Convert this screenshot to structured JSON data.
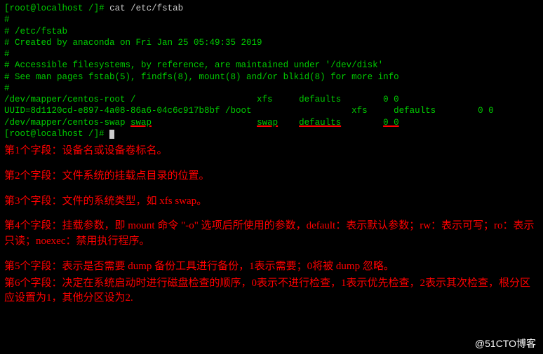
{
  "prompt1": {
    "bracket_open": "[",
    "userhost": "root@localhost",
    "path": " /",
    "bracket_close": "]#",
    "cmd": " cat /etc/fstab"
  },
  "output": {
    "blank": "",
    "hash1": "#",
    "etc": "# /etc/fstab",
    "created": "# Created by anaconda on Fri Jan 25 05:49:35 2019",
    "hash2": "#",
    "accessible": "# Accessible filesystems, by reference, are maintained under '/dev/disk'",
    "seeman": "# See man pages fstab(5), findfs(8), mount(8) and/or blkid(8) for more info",
    "hash3": "#",
    "line1": "/dev/mapper/centos-root /                       xfs     defaults        0 0",
    "line2": "UUID=8d1120cd-e897-4a08-86a6-04c6c917b8bf /boot                   xfs     defaults        0 0",
    "line3_pre": "/dev/mapper/centos-swap ",
    "line3_swap1": "swap",
    "line3_mid1": "                    ",
    "line3_swap2": "swap",
    "line3_mid2": "    ",
    "line3_defaults": "defaults",
    "line3_mid3": "        ",
    "line3_zero": "0 0"
  },
  "prompt2": {
    "bracket_open": "[",
    "userhost": "root@localhost",
    "path": " /",
    "bracket_close": "]#"
  },
  "fields": {
    "f1": "第1个字段：设备名或设备卷标名。",
    "f2": "第2个字段：文件系统的挂载点目录的位置。",
    "f3": "第3个字段：文件的系统类型，如 xfs  swap。",
    "f4": "第4个字段：挂载参数，即 mount 命令 \"-o\" 选项后所使用的参数，default：表示默认参数；rw：表示可写；ro：表示只读；noexec：禁用执行程序。",
    "f5": "第5个字段：表示是否需要 dump 备份工具进行备份，1表示需要；0将被 dump 忽略。",
    "f6": "第6个字段：决定在系统启动时进行磁盘检查的顺序，0表示不进行检查，1表示优先检查，2表示其次检查，根分区应设置为1，其他分区设为2."
  },
  "watermark": "@51CTO博客"
}
